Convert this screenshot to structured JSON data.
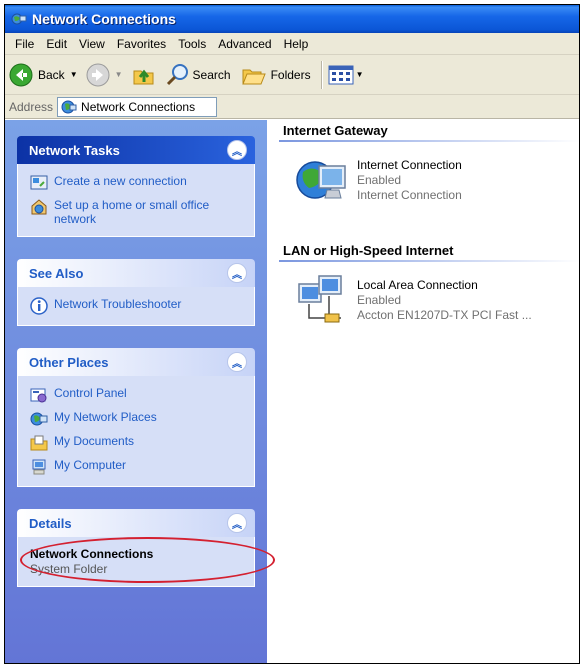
{
  "window": {
    "title": "Network Connections"
  },
  "menu": [
    "File",
    "Edit",
    "View",
    "Favorites",
    "Tools",
    "Advanced",
    "Help"
  ],
  "toolbar": {
    "back_label": "Back",
    "search_label": "Search",
    "folders_label": "Folders"
  },
  "address": {
    "label": "Address",
    "value": "Network Connections"
  },
  "taskpane": {
    "network_tasks": {
      "title": "Network Tasks",
      "items": [
        "Create a new connection",
        "Set up a home or small office network"
      ]
    },
    "see_also": {
      "title": "See Also",
      "items": [
        "Network Troubleshooter"
      ]
    },
    "other_places": {
      "title": "Other Places",
      "items": [
        "Control Panel",
        "My Network Places",
        "My Documents",
        "My Computer"
      ]
    },
    "details": {
      "title": "Details",
      "name": "Network Connections",
      "type": "System Folder"
    }
  },
  "groups": [
    {
      "header": "Internet Gateway",
      "items": [
        {
          "name": "Internet Connection",
          "status": "Enabled",
          "device": "Internet Connection"
        }
      ]
    },
    {
      "header": "LAN or High-Speed Internet",
      "items": [
        {
          "name": "Local Area Connection",
          "status": "Enabled",
          "device": "Accton EN1207D-TX PCI Fast ..."
        }
      ]
    }
  ],
  "colors": {
    "accent": "#215dc6",
    "titlebar": "#0b56d6",
    "annotation": "#d42030"
  }
}
